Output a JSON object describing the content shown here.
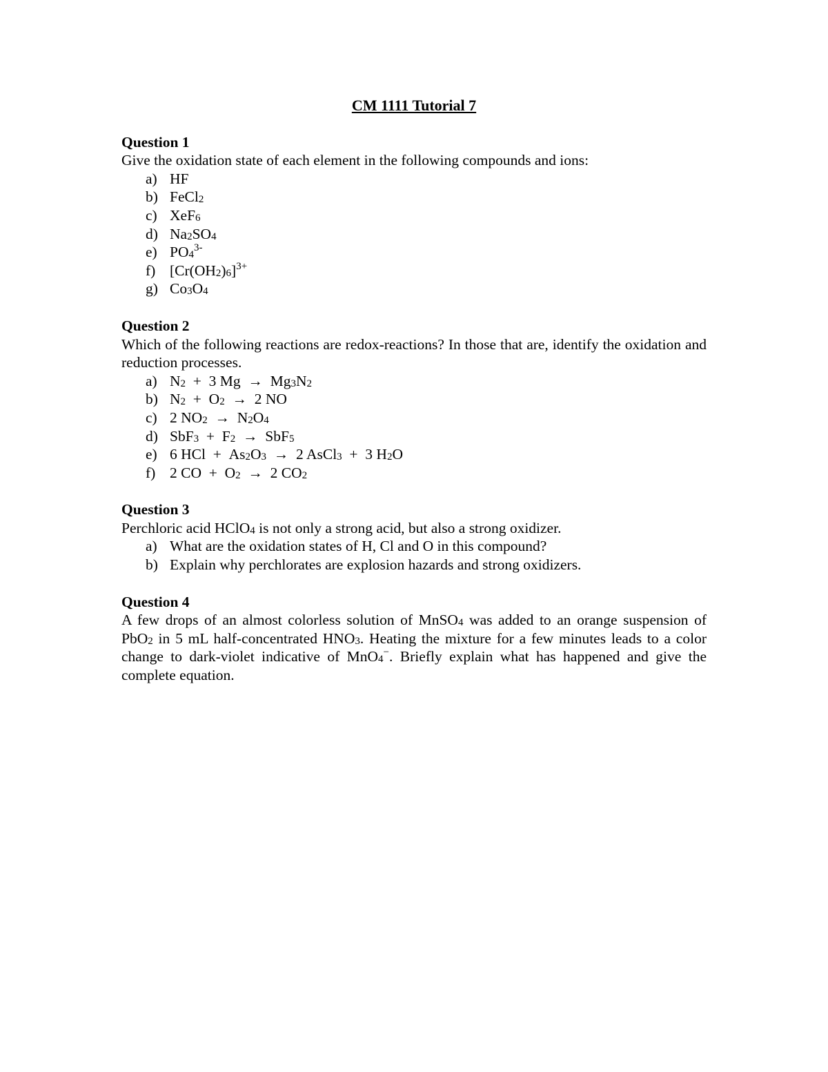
{
  "title": "CM 1111 Tutorial 7",
  "questions": [
    {
      "heading": "Question 1",
      "intro": "Give the oxidation state of each element in the following compounds and ions:",
      "items": [
        {
          "label": "a)",
          "html": "HF"
        },
        {
          "label": "b)",
          "html": "FeCl<sub>2</sub>"
        },
        {
          "label": "c)",
          "html": "XeF<sub>6</sub>"
        },
        {
          "label": "d)",
          "html": "Na<sub>2</sub>SO<sub>4</sub>"
        },
        {
          "label": "e)",
          "html": "PO<sub>4</sub><sup>3-</sup>"
        },
        {
          "label": "f)",
          "html": "[Cr(OH<sub>2</sub>)<sub>6</sub>]<sup>3+</sup>"
        },
        {
          "label": "g)",
          "html": "Co<sub>3</sub>O<sub>4</sub>"
        }
      ]
    },
    {
      "heading": "Question 2",
      "intro": "Which of the following reactions are redox-reactions? In those that are, identify the oxidation and reduction processes.",
      "items": [
        {
          "label": "a)",
          "html": "N<sub>2</sub> &nbsp;+ &nbsp;3 Mg &nbsp;&#8594; &nbsp;Mg<sub>3</sub>N<sub>2</sub>"
        },
        {
          "label": "b)",
          "html": "N<sub>2</sub> &nbsp;+ &nbsp;O<sub>2</sub> &nbsp;&#8594; &nbsp;2 NO"
        },
        {
          "label": "c)",
          "html": "2 NO<sub>2</sub> &nbsp;&#8594; &nbsp;N<sub>2</sub>O<sub>4</sub>"
        },
        {
          "label": "d)",
          "html": "SbF<sub>3</sub> &nbsp;+ &nbsp;F<sub>2</sub> &nbsp;&#8594; &nbsp;SbF<sub>5</sub>"
        },
        {
          "label": "e)",
          "html": "6 HCl &nbsp;+ &nbsp;As<sub>2</sub>O<sub>3</sub> &nbsp;&#8594; &nbsp;2 AsCl<sub>3</sub> &nbsp;+ &nbsp;3 H<sub>2</sub>O"
        },
        {
          "label": "f)",
          "html": "2 CO &nbsp;+ &nbsp;O<sub>2</sub> &nbsp;&#8594; &nbsp;2 CO<sub>2</sub>"
        }
      ]
    },
    {
      "heading": "Question 3",
      "intro_html": "Perchloric acid HClO<sub>4</sub> is not only a strong acid, but also a strong oxidizer.",
      "items": [
        {
          "label": "a)",
          "html": "What are the oxidation states of H, Cl and O in this compound?"
        },
        {
          "label": "b)",
          "html": "Explain why perchlorates are explosion hazards and strong oxidizers."
        }
      ]
    },
    {
      "heading": "Question 4",
      "intro_html": "A few drops of an almost colorless solution of MnSO<sub>4</sub> was added to an orange suspension of PbO<sub>2</sub> in 5 mL half-concentrated HNO<sub>3</sub>. Heating the mixture for a few minutes leads to a color change to dark-violet indicative of MnO<sub>4</sub><sup>&#8722;</sup>. Briefly explain what has happened and give the complete equation."
    }
  ]
}
